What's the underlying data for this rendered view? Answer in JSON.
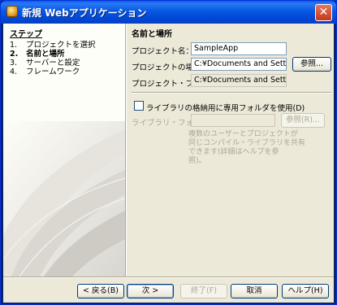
{
  "window": {
    "title": "新規 Webアプリケーション",
    "close_glyph": "✕"
  },
  "steps": {
    "heading": "ステップ",
    "items": [
      {
        "num": "1.",
        "label": "プロジェクトを選択"
      },
      {
        "num": "2.",
        "label": "名前と場所"
      },
      {
        "num": "3.",
        "label": "サーバーと設定"
      },
      {
        "num": "4.",
        "label": "フレームワーク"
      }
    ],
    "current_index": 1
  },
  "form": {
    "section_title": "名前と場所",
    "project_name_label": "プロジェクト名：",
    "project_name_value": "SampleApp",
    "project_location_label": "プロジェクトの場所:",
    "project_location_value": "C:¥Documents and Settings¥r",
    "browse_button": "参照...",
    "project_folder_label": "プロジェクト・フォルダ:",
    "project_folder_value": "C:¥Documents and Settings¥r",
    "library_checkbox_label": "ライブラリの格納用に専用フォルダを使用(D)",
    "library_folder_label": "ライブラリ・フォルダ:",
    "library_folder_value": "",
    "library_browse_button": "参照(R)...",
    "note_lines": [
      "複数のユーザーとプロジェクトが",
      "同じコンパイル・ライブラリを共有",
      "できます(詳細はヘルプを参",
      "照)。"
    ]
  },
  "buttons": {
    "back": "< 戻る(B)",
    "next": "次 >",
    "finish": "終了(F)",
    "cancel": "取消",
    "help": "ヘルプ(H)"
  },
  "colors": {
    "titlebar": "#0054e3",
    "dialog_bg": "#ece9d8",
    "steps_bg": "#fefef8",
    "field_border": "#7f9db9",
    "disabled_text": "#aca899"
  }
}
